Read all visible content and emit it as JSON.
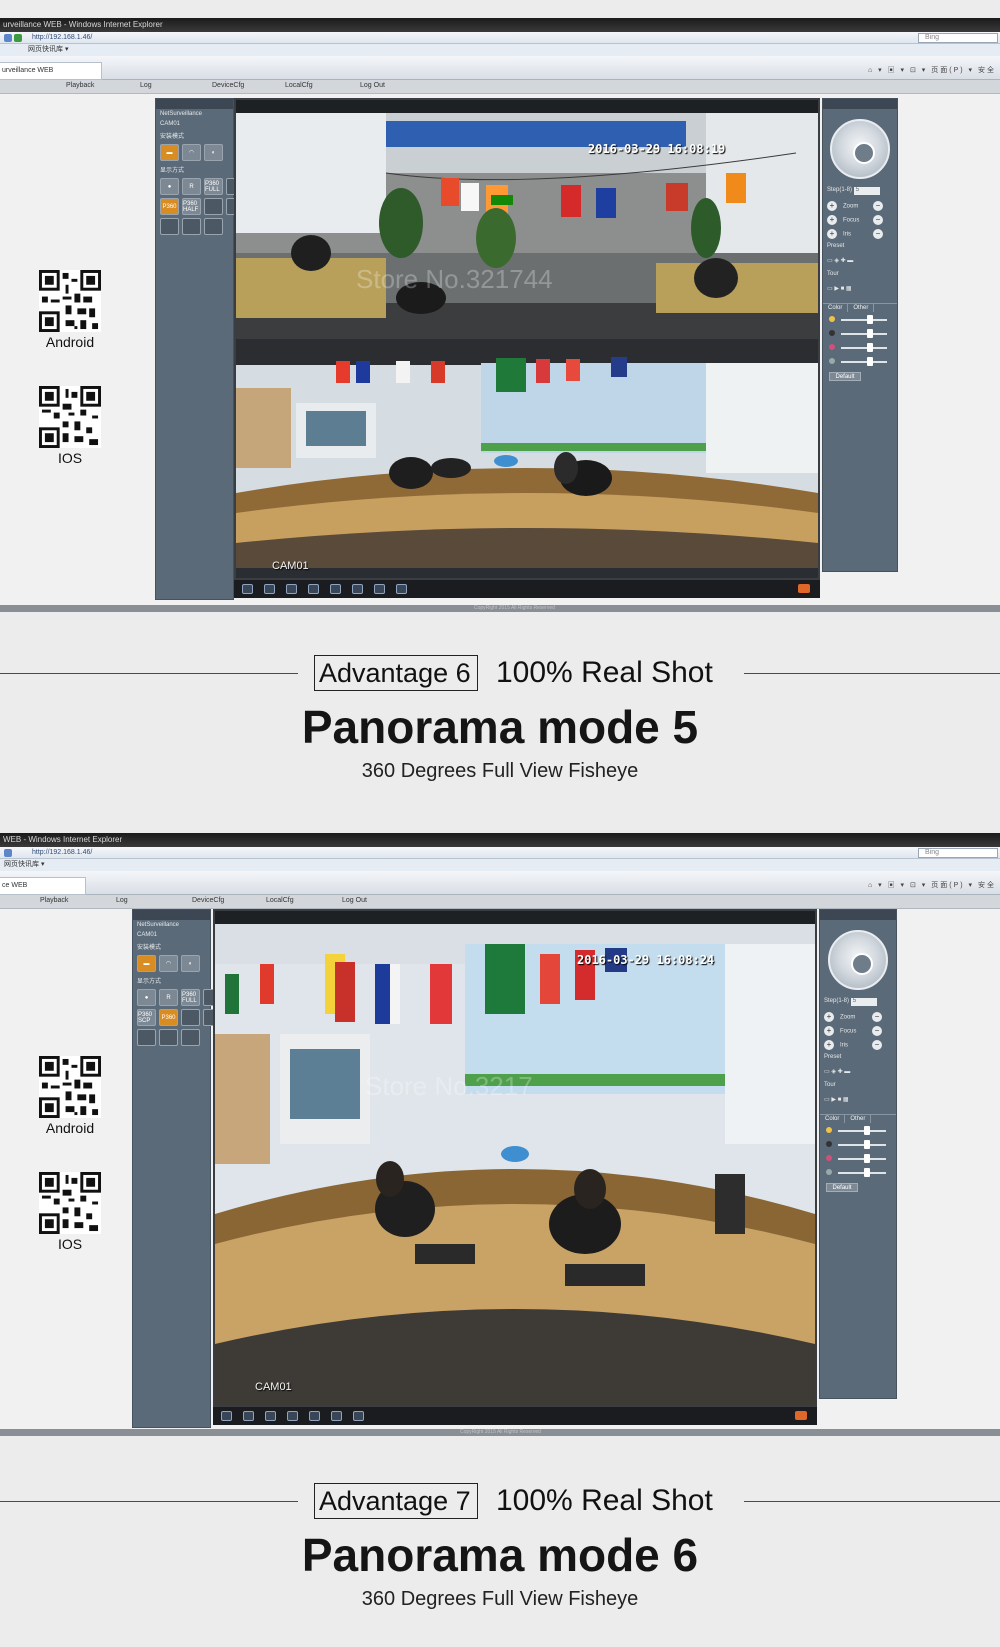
{
  "panels": [
    {
      "browser": {
        "window_title": "urveillance WEB - Windows Internet Explorer",
        "url": "http://192.168.1.46/",
        "search_placeholder": "Bing",
        "favorites": "网页快讯库 ▾",
        "page_tab": "urveillance WEB",
        "toolbar_tools": "⌂ ▾ ▣ ▾ ⊡ ▾ 页面(P) ▾ 安全"
      },
      "menu": [
        "Playback",
        "Log",
        "DeviceCfg",
        "LocalCfg",
        "Log Out"
      ],
      "qr_labels": [
        "Android",
        "IOS"
      ],
      "control": {
        "header": "NetSurveillance",
        "cam_label": "CAM01",
        "install_mode": "安装模式",
        "display_mode": "显示方式",
        "p360_full": "P360 FULL",
        "p360_half": "P360 HALF"
      },
      "video": {
        "timestamp": "2016-03-29 16:08:19",
        "camera_label": "CAM01",
        "watermark": "Store No.321744"
      },
      "ptz": {
        "step_label": "Step(1-8)",
        "step_value": "5",
        "zoom": "Zoom",
        "focus": "Focus",
        "iris": "Iris",
        "preset": "Preset",
        "tour": "Tour",
        "tab_color": "Color",
        "tab_other": "Other",
        "default_btn": "Default"
      },
      "copyright": "CopyRight 2015 All Rights Reserved"
    },
    {
      "browser": {
        "window_title": "WEB - Windows Internet Explorer",
        "url": "http://192.168.1.46/",
        "search_placeholder": "Bing",
        "favorites": "网页快讯库 ▾",
        "page_tab": "ce WEB",
        "toolbar_tools": "⌂ ▾ ▣ ▾ ⊡ ▾ 页面(P) ▾ 安全"
      },
      "menu": [
        "Playback",
        "Log",
        "DeviceCfg",
        "LocalCfg",
        "Log Out"
      ],
      "qr_labels": [
        "Android",
        "IOS"
      ],
      "control": {
        "header": "NetSurveillance",
        "cam_label": "CAM01",
        "install_mode": "安装模式",
        "display_mode": "显示方式",
        "p360_full": "P360 FULL",
        "p360_half": "P360 SCP"
      },
      "video": {
        "timestamp": "2016-03-29 16:08:24",
        "camera_label": "CAM01",
        "watermark": "Store No.3217"
      },
      "ptz": {
        "step_label": "Step(1-8)",
        "step_value": "5",
        "zoom": "Zoom",
        "focus": "Focus",
        "iris": "Iris",
        "preset": "Preset",
        "tour": "Tour",
        "tab_color": "Color",
        "tab_other": "Other",
        "default_btn": "Default"
      },
      "copyright": "CopyRight 2015 All Rights Reserved"
    }
  ],
  "captions": [
    {
      "advantage": "Advantage 6",
      "real_shot": "100% Real Shot",
      "mode": "Panorama mode 5",
      "subtitle": "360 Degrees Full View Fisheye"
    },
    {
      "advantage": "Advantage 7",
      "real_shot": "100% Real Shot",
      "mode": "Panorama mode 6",
      "subtitle": "360 Degrees Full View Fisheye"
    }
  ],
  "colors": {
    "accent_button": "#d88c22",
    "panel_bg": "#5b6a78",
    "video_bg": "#2a2d31"
  }
}
